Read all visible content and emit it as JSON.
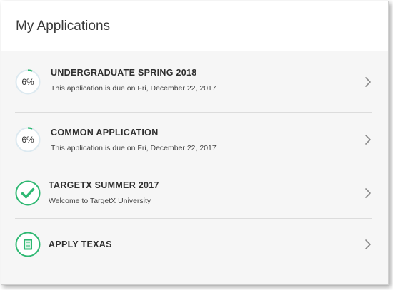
{
  "header": {
    "title": "My Applications"
  },
  "applications": [
    {
      "title": "UNDERGRADUATE SPRING 2018",
      "subtitle": "This application is due on Fri, December 22, 2017",
      "progress_label": "6%",
      "progress": 0.06,
      "status": "in-progress"
    },
    {
      "title": "COMMON APPLICATION",
      "subtitle": "This application is due on Fri, December 22, 2017",
      "progress_label": "6%",
      "progress": 0.06,
      "status": "in-progress"
    },
    {
      "title": "TARGETX SUMMER 2017",
      "subtitle": "Welcome to TargetX University",
      "status": "complete",
      "icon": "checkmark-icon"
    },
    {
      "title": "APPLY TEXAS",
      "status": "external",
      "icon": "document-icon"
    }
  ],
  "colors": {
    "accent_green": "#2eb872",
    "ring_light": "#dce9f0",
    "chevron": "#8a8a8a"
  }
}
